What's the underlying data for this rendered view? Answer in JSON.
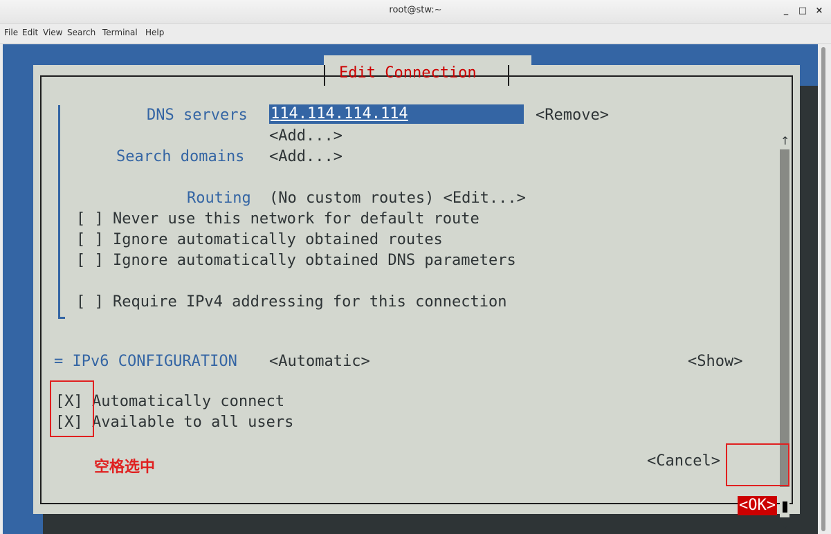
{
  "window": {
    "title": "root@stw:~",
    "minimize": "_",
    "maximize": "□",
    "close": "×"
  },
  "menu": [
    "File",
    "Edit",
    "View",
    "Search",
    "Terminal",
    "Help"
  ],
  "dialog": {
    "title": "Edit Connection",
    "dns_label": "DNS servers",
    "dns_value": "114.114.114.114",
    "remove": "<Remove>",
    "add1": "<Add...>",
    "search_label": "Search domains",
    "add2": "<Add...>",
    "routing_label": "Routing",
    "routing_value": "(No custom routes) <Edit...>",
    "opt1": "[ ] Never use this network for default route",
    "opt2": "[ ] Ignore automatically obtained routes",
    "opt3": "[ ] Ignore automatically obtained DNS parameters",
    "opt4": "[ ] Require IPv4 addressing for this connection",
    "ipv6_label": "= IPv6 CONFIGURATION",
    "ipv6_mode": "<Automatic>",
    "ipv6_show": "<Show>",
    "auto_connect": "[X] Automatically connect",
    "all_users": "[X] Available to all users",
    "cancel": "<Cancel>",
    "ok": "<OK>"
  },
  "annotation": "空格选中",
  "icons": {
    "scroll_up": "↑",
    "scroll_down": "↓"
  },
  "colors": {
    "terminal_bg": "#3465a4",
    "dialog_bg": "#d3d7cf",
    "title_red": "#cc0000",
    "label_blue": "#3465a4",
    "annotation_red": "#e02020"
  }
}
